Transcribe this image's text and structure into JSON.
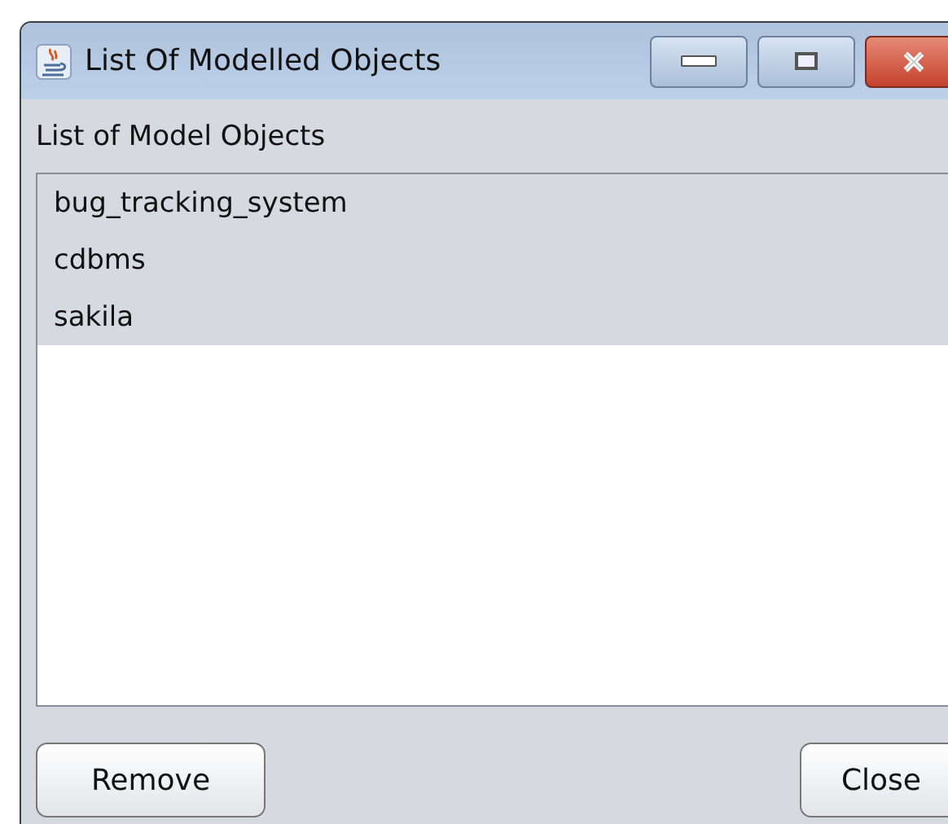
{
  "window": {
    "title": "List Of Modelled Objects"
  },
  "heading": "List of Model Objects",
  "items": [
    {
      "label": "bug_tracking_system",
      "selected": true
    },
    {
      "label": "cdbms",
      "selected": true
    },
    {
      "label": "sakila",
      "selected": true
    }
  ],
  "buttons": [
    {
      "label": "Remove"
    },
    {
      "label": "Close"
    }
  ]
}
